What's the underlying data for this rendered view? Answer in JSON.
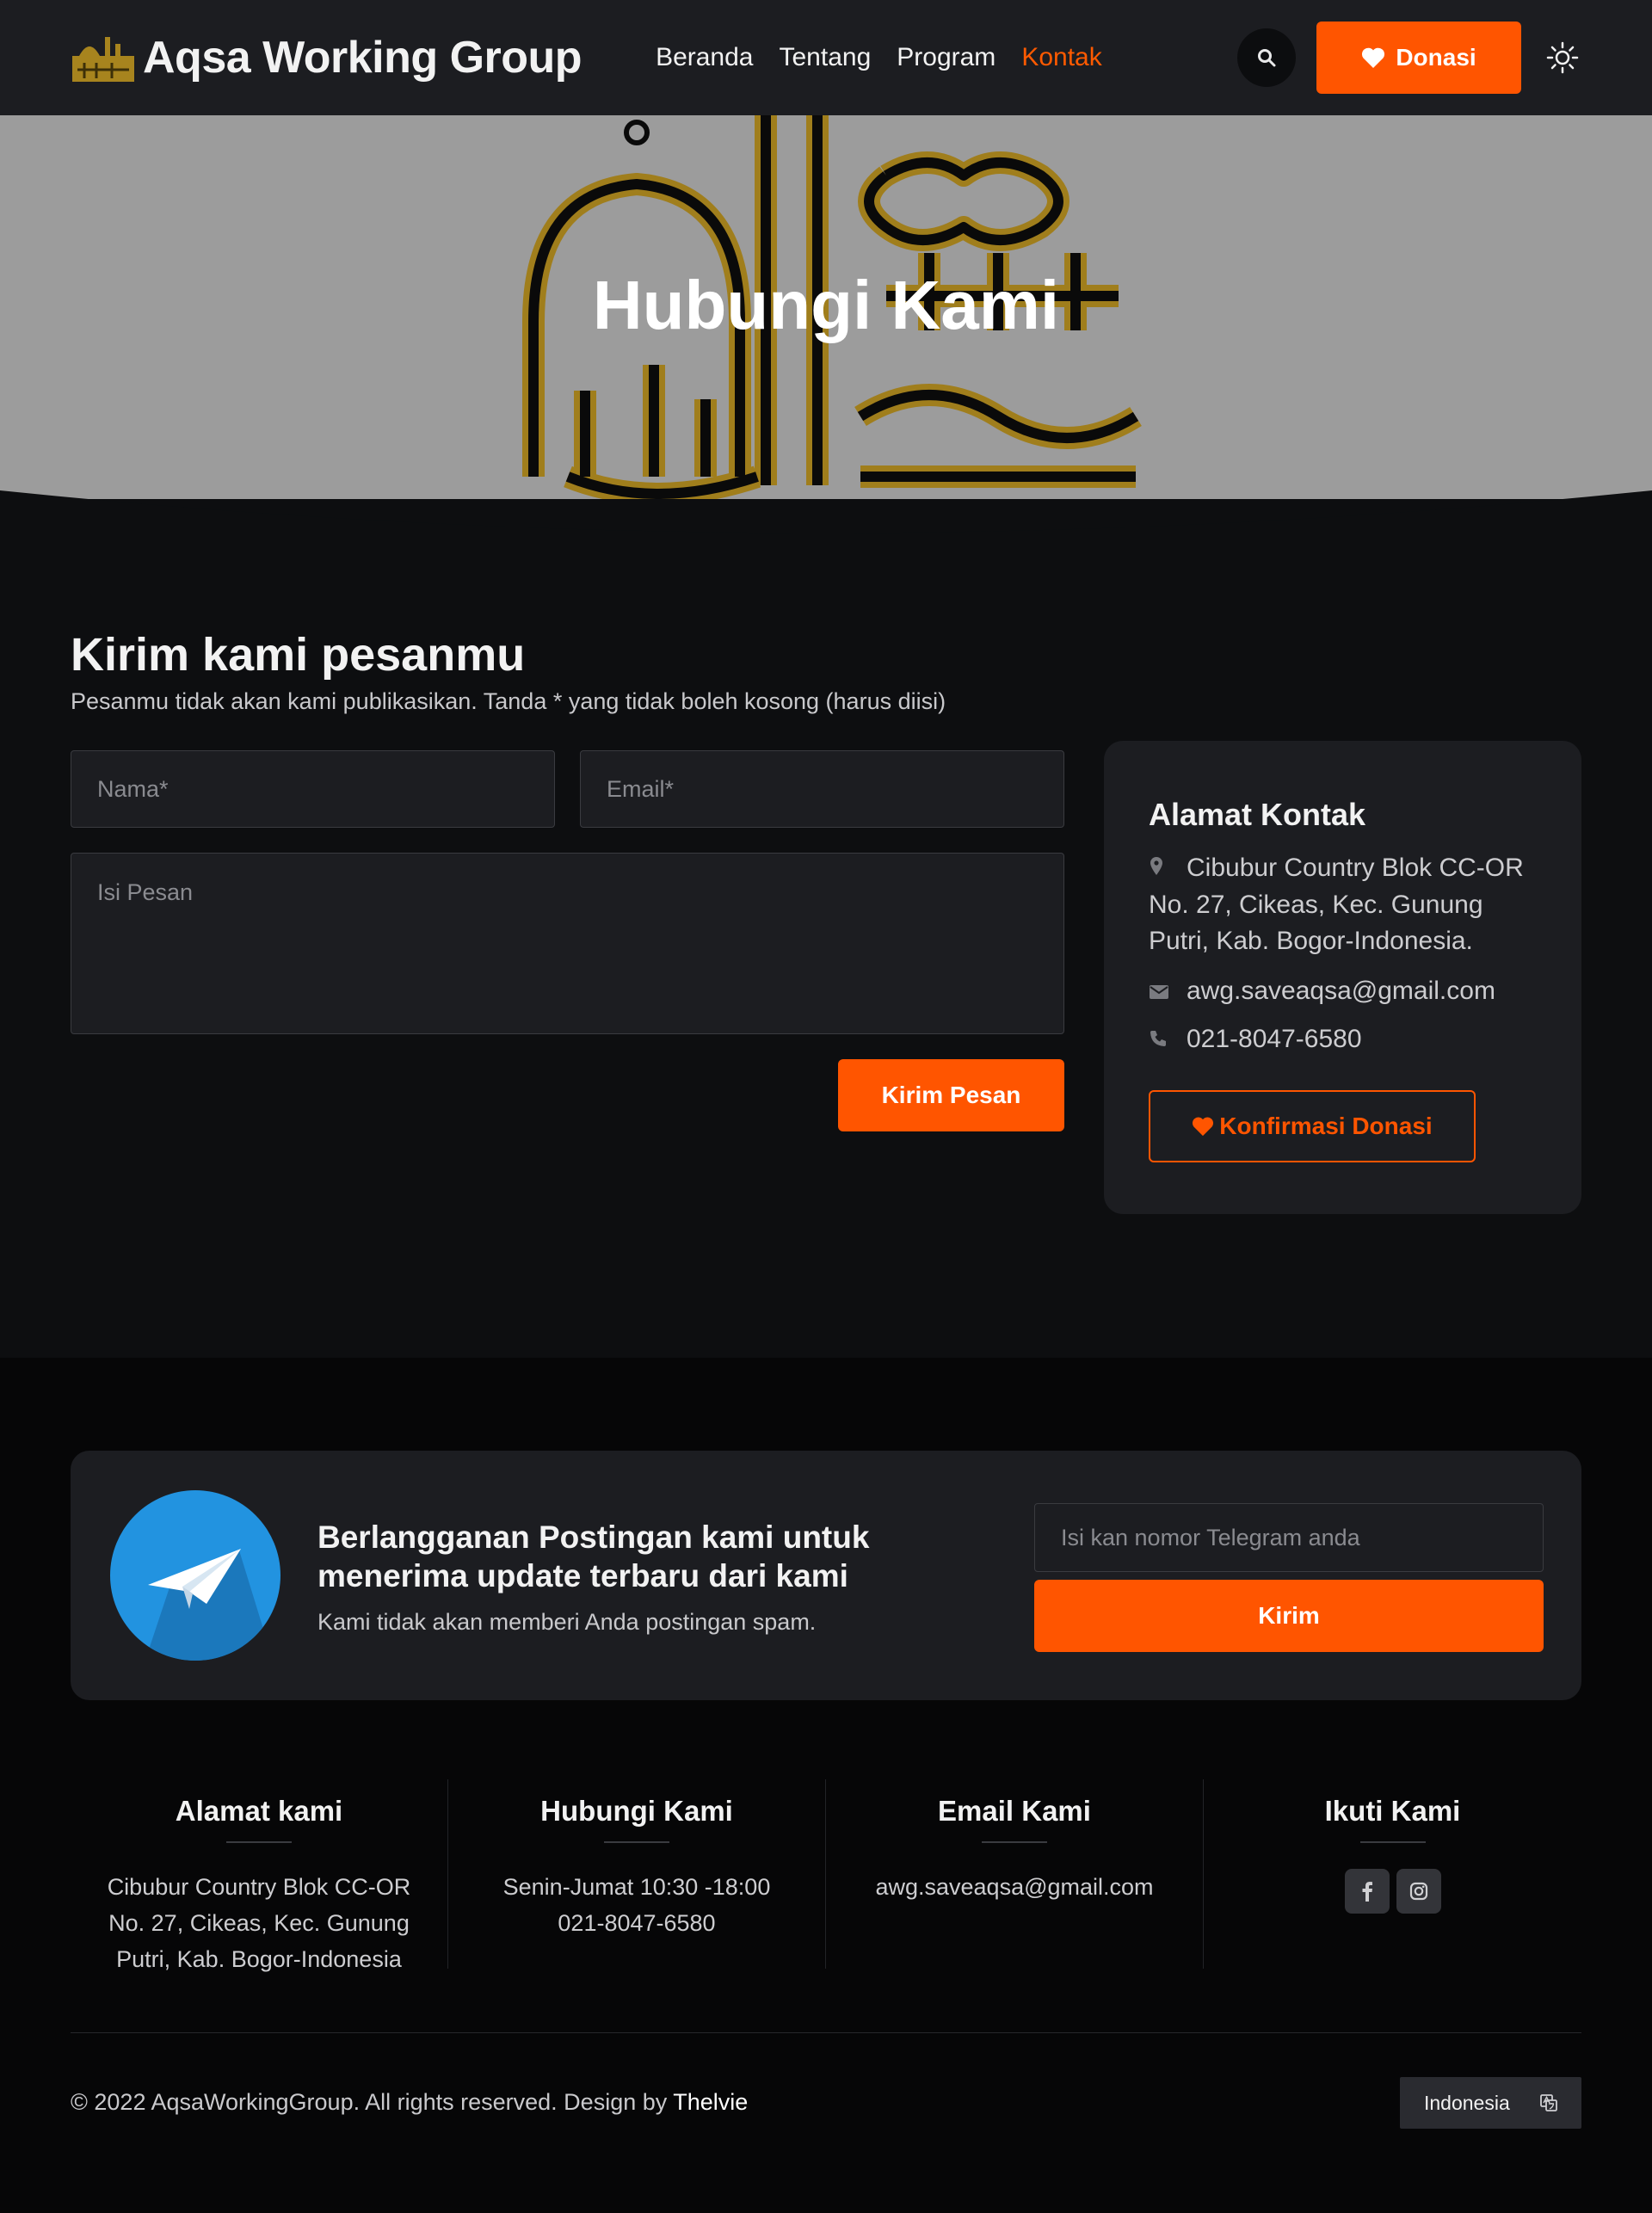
{
  "navbar": {
    "brand": "Aqsa Working Group",
    "links": [
      "Beranda",
      "Tentang",
      "Program",
      "Kontak"
    ],
    "active_link": "Kontak",
    "donate_label": "Donasi",
    "icons": [
      "search-icon",
      "heart-icon",
      "sun-icon"
    ]
  },
  "hero": {
    "title": "Hubungi Kami"
  },
  "contact": {
    "title": "Kirim kami pesanmu",
    "subtitle": "Pesanmu tidak akan kami publikasikan. Tanda * yang tidak boleh kosong (harus diisi)",
    "name_placeholder": "Nama*",
    "email_placeholder": "Email*",
    "message_placeholder": "Isi Pesan",
    "send_label": "Kirim Pesan"
  },
  "card": {
    "title": "Alamat Kontak",
    "address": "Cibubur Country Blok CC-OR No. 27, Cikeas, Kec. Gunung Putri, Kab. Bogor-Indonesia.",
    "email": "awg.saveaqsa@gmail.com",
    "phone": "021-8047-6580",
    "confirm_label": "Konfirmasi Donasi"
  },
  "subscribe": {
    "title": "Berlangganan Postingan kami untuk menerima update terbaru dari kami",
    "desc": "Kami tidak akan memberi Anda postingan spam.",
    "input_placeholder": "Isi kan nomor Telegram anda",
    "button_label": "Kirim"
  },
  "footer": {
    "columns": [
      {
        "title": "Alamat kami",
        "lines": [
          "Cibubur Country Blok CC-OR No. 27, Cikeas, Kec. Gunung Putri, Kab. Bogor-Indonesia"
        ]
      },
      {
        "title": "Hubungi Kami",
        "lines": [
          "Senin-Jumat 10:30 -18:00",
          "021-8047-6580"
        ]
      },
      {
        "title": "Email Kami",
        "lines": [
          "awg.saveaqsa@gmail.com"
        ]
      },
      {
        "title": "Ikuti Kami",
        "socials": [
          "facebook-icon",
          "instagram-icon"
        ]
      }
    ],
    "copyright_prefix": "© 2022 AqsaWorkingGroup. All rights reserved. Design by ",
    "designer": "Thelvie",
    "language": "Indonesia"
  },
  "colors": {
    "accent": "#ff5500",
    "navbar_bg": "#1c1d21",
    "page_bg": "#0d0e10",
    "footer_bg": "#060607",
    "card_bg": "#1c1d21",
    "telegram_blue": "#2293e0"
  }
}
